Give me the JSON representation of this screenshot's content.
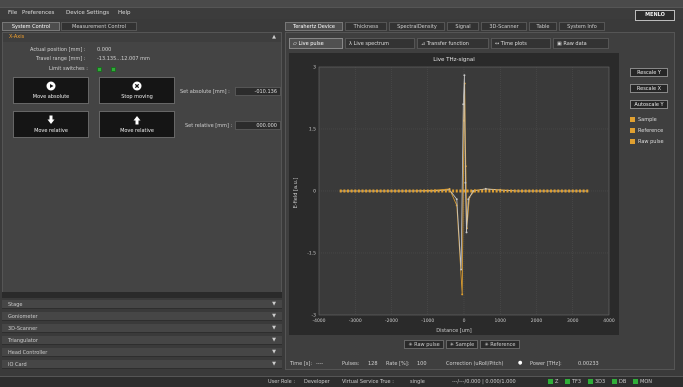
{
  "menu": [
    "File",
    "Preferences",
    "Device Settings",
    "Help"
  ],
  "logo": "MENLO",
  "left_tabs": [
    "System Control",
    "Measurement Control"
  ],
  "axis_section": {
    "title": "X-Axis",
    "actual_position_label": "Actual position [mm] :",
    "actual_position_value": "0.000",
    "travel_range_label": "Travel range [mm] :",
    "travel_range_value": "-13.135...12.007 mm",
    "limit_switches_label": "Limit switches :",
    "move_absolute": "Move absolute",
    "stop_moving": "Stop moving",
    "move_relative_minus": "Move relative",
    "move_relative_plus": "Move relative",
    "set_absolute_label": "Set absolute [mm] :",
    "set_absolute_value": "-010.136",
    "set_relative_label": "Set relative [mm] :",
    "set_relative_value": "000.000"
  },
  "accordion": [
    "Stage",
    "Goniometer",
    "3D-Scanner",
    "Triangulator",
    "Head Controller",
    "IO Card"
  ],
  "right_tabs": [
    "Terahertz Device",
    "Thickness",
    "SpectralDensity",
    "Signal",
    "3D-Scanner",
    "Table",
    "System Info"
  ],
  "sub_tabs": [
    "Live pulse",
    "Live spectrum",
    "Transfer function",
    "Time plots",
    "Raw data"
  ],
  "buttons": {
    "rescale_y": "Rescale Y",
    "rescale_x": "Rescale X",
    "autoscale_y": "Autoscale Y"
  },
  "legend": [
    "Sample",
    "Reference",
    "Raw pulse"
  ],
  "plot_toggles": [
    "Raw pulse",
    "Sample",
    "Reference"
  ],
  "readout": {
    "time_label": "Time [s]:",
    "time_value": "----",
    "pulses_label": "Pulses:",
    "pulses_value": "128",
    "rate_label": "Rate [%]:",
    "rate_value": "100",
    "correction_label": "Correction (uRoll/Pitch)",
    "power_label": "Power [THz]:",
    "power_value": "0.00233"
  },
  "status": {
    "user_role": "User Role :",
    "user_role_value": "Developer",
    "virtual_label": "Virtual Service True :",
    "virtual_value": "single",
    "coords": "---/---/0.000 | 0.000/1.000",
    "indicators": [
      "Z",
      "TF3",
      "3D3",
      "DB",
      "MON"
    ]
  },
  "colors": {
    "accent": "#f0a030",
    "sample": "#e0a030",
    "reference": "#c8c8c8",
    "led": "#2fae38"
  },
  "chart_data": {
    "type": "line",
    "title": "Live THz-signal",
    "xlabel": "Distance [um]",
    "ylabel": "E-field [a.u.]",
    "xlim": [
      -4000,
      4000
    ],
    "ylim": [
      -3,
      3
    ],
    "xticks": [
      -4000,
      -3000,
      -2000,
      -1000,
      0,
      1000,
      2000,
      3000,
      4000
    ],
    "yticks": [
      3,
      1.5,
      0,
      -1.5,
      -3
    ],
    "ytick_labels": [
      "3",
      "1.5",
      "0",
      "-1.5",
      "-3"
    ],
    "grid": true,
    "series": [
      {
        "name": "Sample",
        "color": "#e0a030",
        "x": [
          -3400,
          -2500,
          -1500,
          -800,
          -400,
          -200,
          -50,
          0,
          20,
          50,
          80,
          150,
          300,
          600,
          1000,
          1500,
          2500,
          3400
        ],
        "y": [
          0,
          0,
          0,
          0.02,
          0.05,
          -0.35,
          -2.5,
          1.7,
          2.6,
          0.6,
          -0.9,
          -0.15,
          0.02,
          0.05,
          0.03,
          0,
          0,
          0
        ]
      },
      {
        "name": "Reference",
        "color": "#c8c8c8",
        "x": [
          -3400,
          -2500,
          -1500,
          -800,
          -400,
          -200,
          -80,
          -20,
          10,
          40,
          70,
          120,
          250,
          600,
          1000,
          1500,
          2500,
          3400
        ],
        "y": [
          0,
          0,
          0,
          0,
          0.03,
          -0.2,
          -1.9,
          2.1,
          2.8,
          0.2,
          -1.0,
          -0.2,
          0,
          0.05,
          0.02,
          0,
          0,
          0
        ]
      }
    ]
  }
}
